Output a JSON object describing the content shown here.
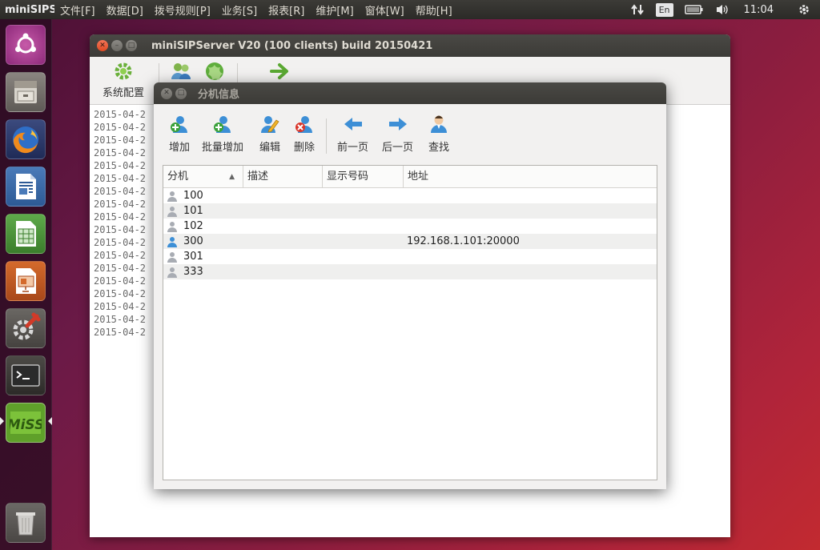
{
  "top_panel": {
    "app_name": "miniSIPS",
    "menus": [
      "文件[F]",
      "数据[D]",
      "拨号规则[P]",
      "业务[S]",
      "报表[R]",
      "维护[M]",
      "窗体[W]",
      "帮助[H]"
    ],
    "lang": "En",
    "clock": "11:04"
  },
  "launcher": {
    "icons": [
      "ubuntu-dash-icon",
      "files-icon",
      "firefox-icon",
      "writer-icon",
      "calc-icon",
      "impress-icon",
      "system-settings-icon",
      "terminal-icon",
      "miss-app-icon",
      "trash-icon"
    ]
  },
  "main_window": {
    "title": "miniSIPServer V20 (100 clients) build 20150421",
    "toolbar": {
      "system_config_label": "系统配置"
    },
    "log_lines": [
      "2015-04-2",
      "2015-04-2",
      "2015-04-2",
      "2015-04-2",
      "2015-04-2",
      "2015-04-2",
      "2015-04-2",
      "2015-04-2",
      "2015-04-2",
      "2015-04-2",
      "2015-04-2",
      "2015-04-2",
      "2015-04-2",
      "2015-04-2",
      "2015-04-2",
      "2015-04-2",
      "2015-04-2",
      "2015-04-2"
    ]
  },
  "dialog": {
    "title": "分机信息",
    "toolbar": {
      "add": "增加",
      "batch_add": "批量增加",
      "edit": "编辑",
      "delete": "删除",
      "prev_page": "前一页",
      "next_page": "后一页",
      "find": "查找"
    },
    "table": {
      "columns": [
        "分机",
        "描述",
        "显示号码",
        "地址"
      ],
      "rows": [
        {
          "ext": "100",
          "desc": "",
          "display": "",
          "addr": "",
          "online": false
        },
        {
          "ext": "101",
          "desc": "",
          "display": "",
          "addr": "",
          "online": false
        },
        {
          "ext": "102",
          "desc": "",
          "display": "",
          "addr": "",
          "online": false
        },
        {
          "ext": "300",
          "desc": "",
          "display": "",
          "addr": "192.168.1.101:20000",
          "online": true
        },
        {
          "ext": "301",
          "desc": "",
          "display": "",
          "addr": "",
          "online": false
        },
        {
          "ext": "333",
          "desc": "",
          "display": "",
          "addr": "",
          "online": false
        }
      ]
    }
  },
  "colors": {
    "online_user": "#3d8fd6",
    "offline_user": "#a8acb3",
    "titlebar": "#3c3b37",
    "close_button": "#e25a32"
  }
}
